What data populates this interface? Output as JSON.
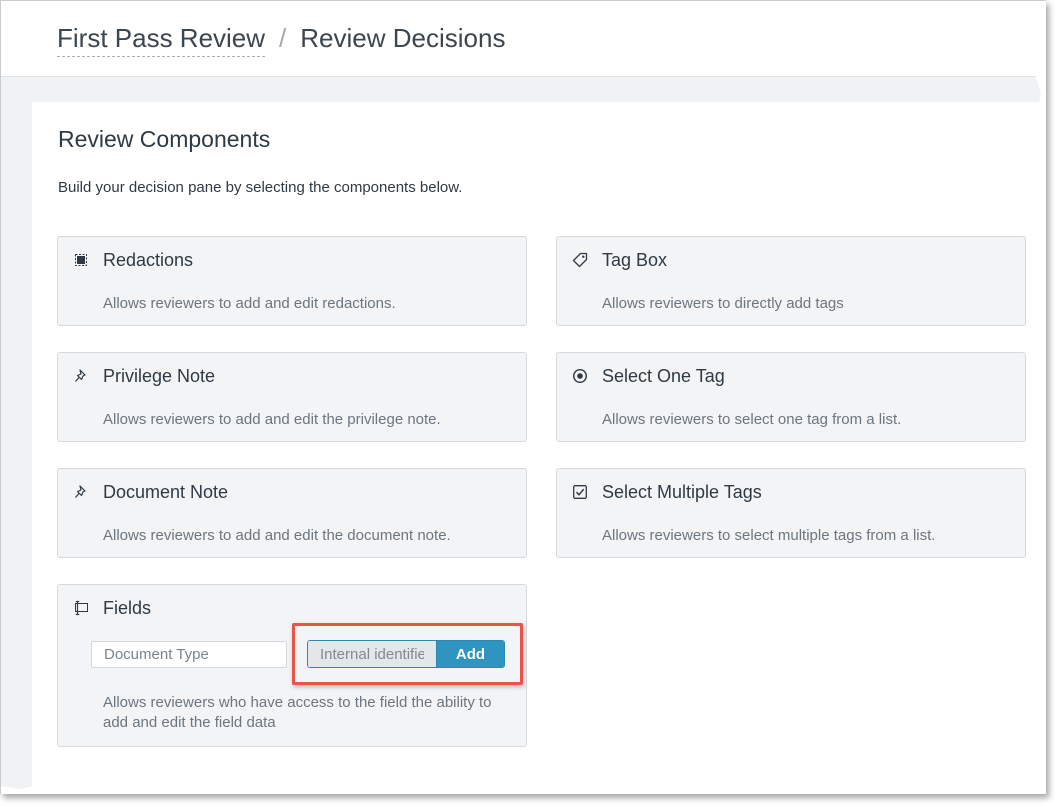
{
  "breadcrumb": {
    "parent": "First Pass Review",
    "separator": "/",
    "current": "Review Decisions"
  },
  "section": {
    "title": "Review Components",
    "subtitle": "Build your decision pane by selecting the components below."
  },
  "components": [
    {
      "id": "redactions",
      "icon": "redaction-icon",
      "title": "Redactions",
      "description": "Allows reviewers to add and edit redactions."
    },
    {
      "id": "tag-box",
      "icon": "tag-icon",
      "title": "Tag Box",
      "description": "Allows reviewers to directly add tags"
    },
    {
      "id": "privilege-note",
      "icon": "pin-icon",
      "title": "Privilege Note",
      "description": "Allows reviewers to add and edit the privilege note."
    },
    {
      "id": "select-one-tag",
      "icon": "radio-icon",
      "title": "Select One Tag",
      "description": "Allows reviewers to select one tag from a list."
    },
    {
      "id": "document-note",
      "icon": "pin-icon",
      "title": "Document Note",
      "description": "Allows reviewers to add and edit the document note."
    },
    {
      "id": "select-multiple-tags",
      "icon": "checkbox-icon",
      "title": "Select Multiple Tags",
      "description": "Allows reviewers to select multiple tags from a list."
    }
  ],
  "fields": {
    "icon": "text-field-icon",
    "title": "Fields",
    "field_value": "Document Type",
    "combo_value": "Internal identifie",
    "add_label": "Add",
    "description": "Allows reviewers who have access to the field the ability to add and edit the field data"
  },
  "colors": {
    "accent": "#2f94bf",
    "highlight": "#e8544a",
    "card_bg": "#f3f4f5"
  }
}
